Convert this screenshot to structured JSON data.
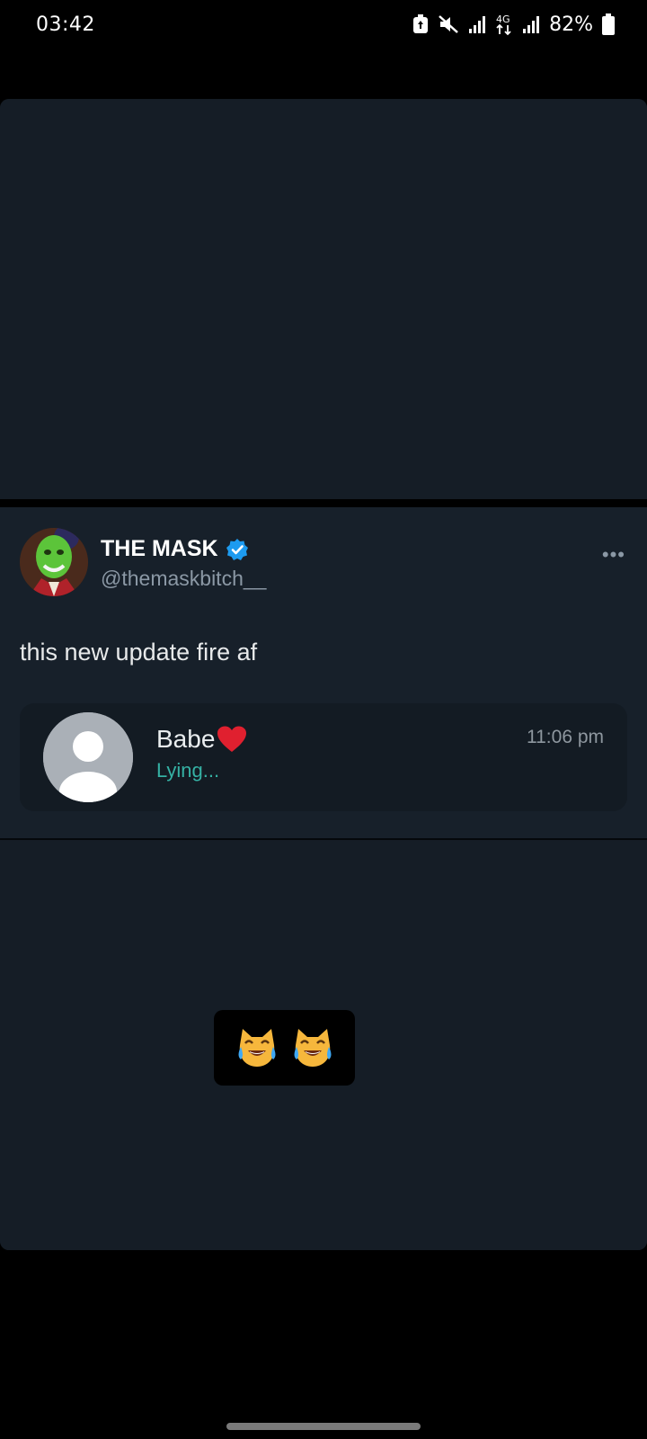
{
  "status_bar": {
    "time": "03:42",
    "battery": "82%",
    "network": "4G",
    "icons": [
      "battery-saver-icon",
      "mute-icon",
      "signal-icon",
      "data-arrows-icon",
      "signal-icon",
      "battery-icon"
    ]
  },
  "tweet": {
    "author_name": "THE MASK",
    "author_handle": "@themaskbitch__",
    "text": "this new update fire af",
    "more_label": "•••",
    "embedded_chat": {
      "contact_name": "Babe",
      "contact_status": "Lying...",
      "time": "11:06 pm"
    }
  },
  "caption": {
    "icons": [
      "crying-laughing-cat-icon",
      "crying-laughing-cat-icon"
    ]
  },
  "colors": {
    "background": "#000000",
    "card": "#151d26",
    "tweet_bg": "#17202a",
    "verified_blue": "#1d9bf0",
    "status_teal": "#35b1a4",
    "heart_red": "#e0202f"
  }
}
